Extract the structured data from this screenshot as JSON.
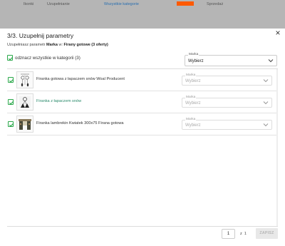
{
  "background": {
    "strip_texts": [
      "Ikonki",
      "Uzupełnianie",
      "Dodaj",
      "Sprzedaż"
    ],
    "strip_link": "Wszystkie kategorie",
    "accent": "#ff5a00"
  },
  "modal": {
    "title": "3/3. Uzupełnij parametry",
    "subtitle_prefix": "Uzupełniasz parametr",
    "param_name": "Marka",
    "subtitle_mid": "w:",
    "category": "Firany gotowe (3 oferty)",
    "close_icon": "close-icon",
    "select_all_label": "odznacz wszystkie w kategorii (3)",
    "bulk_select": {
      "label": "Marka",
      "value": "Wybierz"
    }
  },
  "rows": [
    {
      "name": "Firanka gotowa z łapaczem snów Woal Producent",
      "link": false,
      "select_label": "Marka",
      "select_value": "Wybierz"
    },
    {
      "name": "Firanka z łapaczem snów",
      "link": true,
      "select_label": "Marka",
      "select_value": "Wybierz"
    },
    {
      "name": "Firanka lambrekin Kwiatek 300x75 Firana gotowa",
      "link": false,
      "select_label": "Marka",
      "select_value": "Wybierz"
    }
  ],
  "footer": {
    "page_value": "1",
    "page_sep": "z",
    "page_total": "1",
    "save_label": "ZAPISZ"
  },
  "colors": {
    "check": "#2aa84a",
    "link": "#2a8a6b",
    "save_disabled_bg": "#e8e8e8"
  }
}
